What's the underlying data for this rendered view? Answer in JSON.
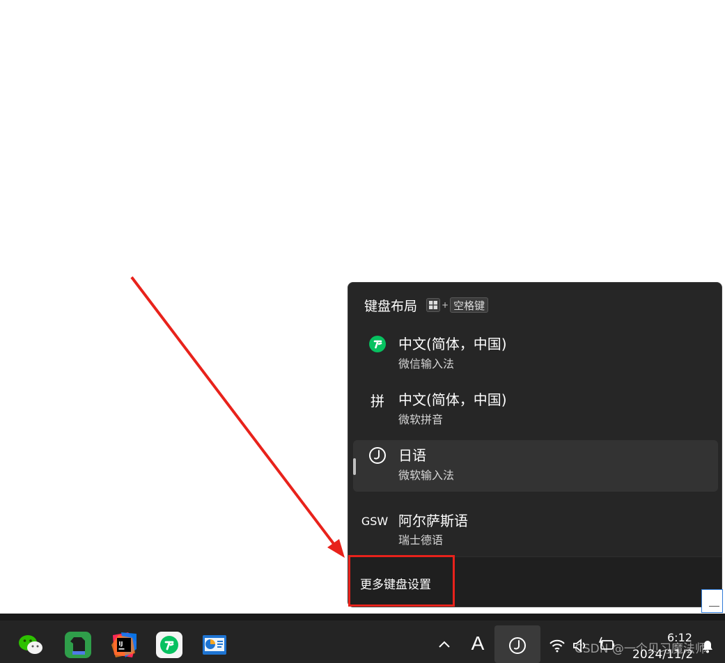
{
  "flyout": {
    "title": "键盘布局",
    "shortcut_plus": "+",
    "shortcut_key": "空格键",
    "languages": [
      {
        "icon": "wechat-ime-icon",
        "icon_text": "",
        "name": "中文(简体，中国)",
        "ime": "微信输入法",
        "selected": false
      },
      {
        "icon": "pinyin-icon",
        "icon_text": "拼",
        "name": "中文(简体，中国)",
        "ime": "微软拼音",
        "selected": false
      },
      {
        "icon": "japanese-ime-icon",
        "icon_text": "",
        "name": "日语",
        "ime": "微软输入法",
        "selected": true
      },
      {
        "icon": "gsw-icon",
        "icon_text": "GSW",
        "name": "阿尔萨斯语",
        "ime": "瑞士德语",
        "selected": false
      }
    ],
    "more_settings": "更多键盘设置"
  },
  "taskbar": {
    "apps": [
      "wechat-icon",
      "evernote-icon",
      "intellij-idea-icon",
      "wechat-ime-app-icon",
      "presentation-app-icon"
    ],
    "tray": {
      "overflow_icon": "chevron-up-icon",
      "font_glyph": "A",
      "ime_icon": "japanese-ime-icon",
      "wifi_icon": "wifi-icon",
      "volume_icon": "speaker-icon",
      "battery_icon": "battery-charging-icon",
      "notification_icon": "bell-icon"
    },
    "time": "6:12",
    "date": "2024/11/2",
    "watermark": "CSDN @一个贝习魔法师"
  },
  "colors": {
    "flyout_bg": "#262626",
    "highlight_red": "#e8221b",
    "wechat_green": "#07c160"
  }
}
